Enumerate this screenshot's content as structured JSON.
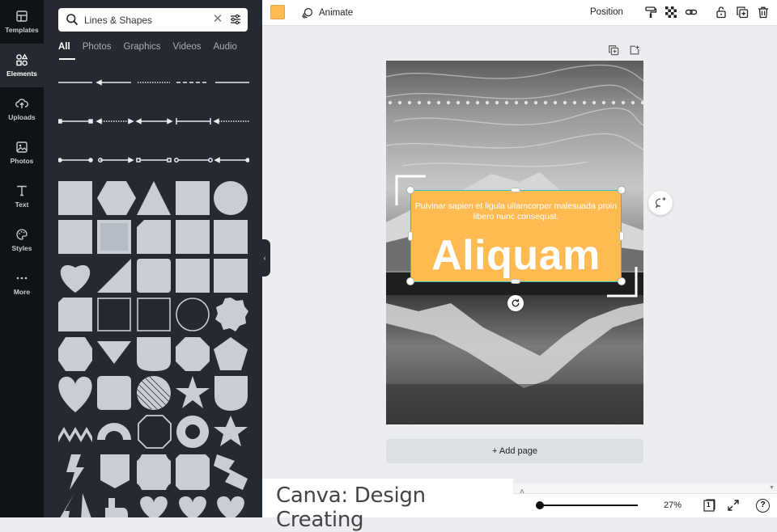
{
  "rail": [
    {
      "label": "Templates",
      "icon": "templates-icon"
    },
    {
      "label": "Elements",
      "icon": "elements-icon",
      "active": true
    },
    {
      "label": "Uploads",
      "icon": "uploads-icon"
    },
    {
      "label": "Photos",
      "icon": "photos-icon"
    },
    {
      "label": "Text",
      "icon": "text-icon"
    },
    {
      "label": "Styles",
      "icon": "styles-icon"
    },
    {
      "label": "More",
      "icon": "more-icon"
    }
  ],
  "panel": {
    "search": {
      "value": "Lines & Shapes"
    },
    "tabs": [
      "All",
      "Photos",
      "Graphics",
      "Videos",
      "Audio"
    ],
    "active_tab": "All"
  },
  "toolbar": {
    "color": "#ffba52",
    "animate_label": "Animate",
    "position_label": "Position"
  },
  "design": {
    "small_text": "Pulvinar sapien et ligula ullamcorper malesuada proin libero nunc consequat.",
    "headline": "Aliquam",
    "box_color": "#ffba52",
    "selection_color": "#2bc3c0"
  },
  "add_page_label": "+ Add page",
  "bottom": {
    "caption": "Canva: Design Creating",
    "zoom": "27%",
    "page_number": "1",
    "help": "?"
  }
}
